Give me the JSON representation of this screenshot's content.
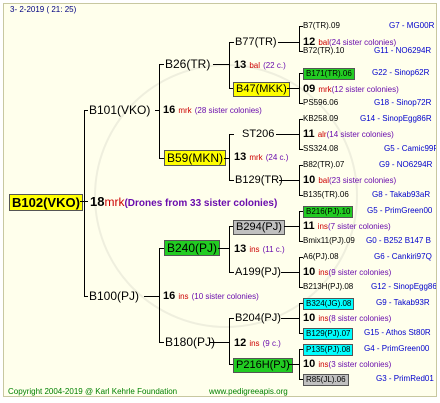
{
  "date": "3-  2-2019  ( 21:  25)",
  "footer": {
    "copyright": "Copyright 2004-2019 @ Karl Kehrle Foundation",
    "site": "www.pedigreeapis.org"
  },
  "root": {
    "id": "B102(VKO)",
    "num": "18",
    "unit": "mrk",
    "note": "(Drones from 33 sister colonies)"
  },
  "gen1": [
    {
      "id": "B101(VKO)",
      "num": "16",
      "unit": "mrk",
      "note": "(28 sister colonies)"
    },
    {
      "id": "B100(PJ)",
      "num": "16",
      "unit": "ins",
      "note": "(10 sister colonies)"
    }
  ],
  "gen2": [
    {
      "id": "B26(TR)",
      "num": "13",
      "unit": "bal",
      "note": "(22 c.)"
    },
    {
      "id": "B59(MKN)",
      "num": "13",
      "unit": "mrk",
      "note": "(24 c.)"
    },
    {
      "id": "B240(PJ)",
      "num": "13",
      "unit": "ins",
      "note": "(11 c.)"
    },
    {
      "id": "B180(PJ)",
      "num": "12",
      "unit": "ins",
      "note": "(9 c.)"
    }
  ],
  "gen3": [
    {
      "id": "B77(TR)",
      "num": "12",
      "unit": "bal",
      "note": "(24 sister colonies)"
    },
    {
      "id": "B47(MKK)",
      "num": "09",
      "unit": "mrk",
      "note": "(12 sister colonies)"
    },
    {
      "id": "ST206",
      "num": "11",
      "unit": "alr",
      "note": "(14 sister colonies)"
    },
    {
      "id": "B129(TR)",
      "num": "10",
      "unit": "bal",
      "note": "(23 sister colonies)"
    },
    {
      "id": "B294(PJ)",
      "num": "11",
      "unit": "ins",
      "note": "(7 sister colonies)"
    },
    {
      "id": "A199(PJ)",
      "num": "10",
      "unit": "ins",
      "note": "(9 sister colonies)"
    },
    {
      "id": "B204(PJ)",
      "num": "10",
      "unit": "ins",
      "note": "(8 sister colonies)"
    },
    {
      "id": "P216H(PJ)",
      "num": "10",
      "unit": "ins",
      "note": "(3 sister colonies)"
    }
  ],
  "gen4": [
    {
      "id": "B7(TR).09",
      "note": "G7 - MG00R"
    },
    {
      "id": "B72(TR).10",
      "note": "G11 - NO6294R"
    },
    {
      "id": "B171(TR).06",
      "note": "G22 - Sinop62R"
    },
    {
      "id": "PS596.06",
      "note": "G18 - Sinop72R"
    },
    {
      "id": "KB258.09",
      "note": "G14 - SinopEgg86R"
    },
    {
      "id": "SS324.08",
      "note": "G5 - Camic99R"
    },
    {
      "id": "B82(TR).07",
      "note": "G9 - NO6294R"
    },
    {
      "id": "B135(TR).06",
      "note": "G8 - Takab93aR"
    },
    {
      "id": "B216(PJ).10",
      "note": "G5 - PrimGreen00"
    },
    {
      "id": "Bmix11(PJ).09",
      "note": "G0 - B252 B147 B"
    },
    {
      "id": "A6(PJ).08",
      "note": "G6 - Cankiri97Q"
    },
    {
      "id": "B213H(PJ).08",
      "note": "G12 - SinopEgg86R"
    },
    {
      "id": "B324(JG).08",
      "note": "G9 - Takab93R"
    },
    {
      "id": "B129(PJ).07",
      "note": "G15 - Athos St80R"
    },
    {
      "id": "P135(PJ).08",
      "note": "G4 - PrimGreen00"
    },
    {
      "id": "R85(JL).06",
      "note": "G3 - PrimRed01"
    }
  ]
}
